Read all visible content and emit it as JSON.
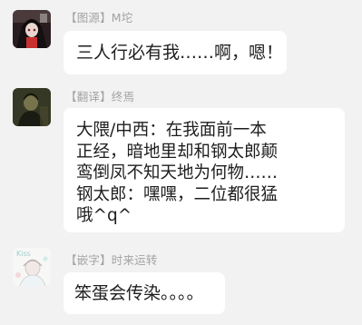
{
  "colors": {
    "background": "#f2f2f2",
    "bubble": "#ffffff",
    "sender_text": "#a3a3a3",
    "message_text": "#1e1e1e"
  },
  "messages": [
    {
      "avatar_icon": "dark-portrait-avatar",
      "sender": "【图源】M坨",
      "lines": [
        "三人行必有我……啊，嗯！"
      ]
    },
    {
      "avatar_icon": "dark-figure-avatar",
      "sender": "【翻译】终焉",
      "lines": [
        "大隈/中西：在我面前一本",
        "正经，暗地里却和钢太郎颠",
        "鸾倒凤不知天地为何物……",
        "钢太郎：嘿嘿，二位都很猛",
        "哦^q^"
      ]
    },
    {
      "avatar_icon": "light-sketch-avatar",
      "sender": "【嵌字】时来运转",
      "lines": [
        "笨蛋会传染。。。。"
      ]
    }
  ]
}
